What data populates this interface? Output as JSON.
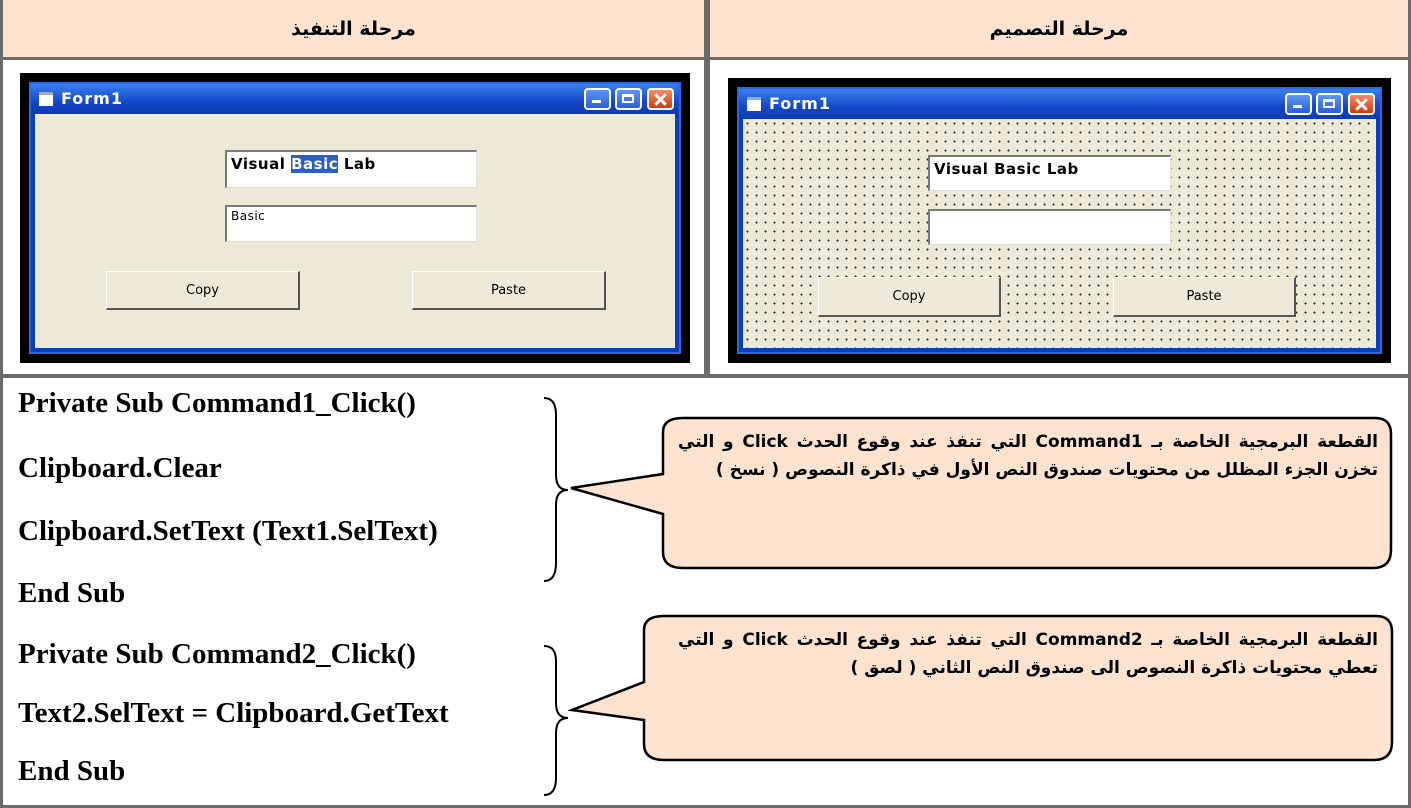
{
  "header": {
    "execution_label": "مرحلة التنفيذ",
    "design_label": "مرحلة التصميم"
  },
  "run_form": {
    "title": "Form1",
    "text1_before": "Visual ",
    "text1_selected": "Basic",
    "text1_after": " Lab",
    "text2": "Basic",
    "copy_label": "Copy",
    "paste_label": "Paste"
  },
  "design_form": {
    "title": "Form1",
    "text1": "Visual Basic Lab",
    "text2": "",
    "copy_label": "Copy",
    "paste_label": "Paste"
  },
  "code": {
    "block1": [
      "Private Sub Command1_Click()",
      "Clipboard.Clear",
      "Clipboard.SetText (Text1.SelText)",
      "End Sub"
    ],
    "block2": [
      "Private Sub Command2_Click()",
      "Text2.SelText = Clipboard.GetText",
      "End Sub"
    ]
  },
  "notes": {
    "note1": "القطعة البرمجية الخاصة بـ Command1 التي تنفذ عند وقوع الحدث Click و التي تخزن الجزء المظلل من محتويات صندوق النص الأول في ذاكرة النصوص ( نسخ )",
    "note2": "القطعة البرمجية الخاصة بـ Command2 التي تنفذ عند وقوع الحدث Click و التي تعطي محتويات ذاكرة النصوص الى صندوق النص الثاني ( لصق )"
  },
  "colors": {
    "header_bg": "#fbe3cf",
    "bubble_bg": "#fbe3cf",
    "selection": "#2b5fc8"
  }
}
